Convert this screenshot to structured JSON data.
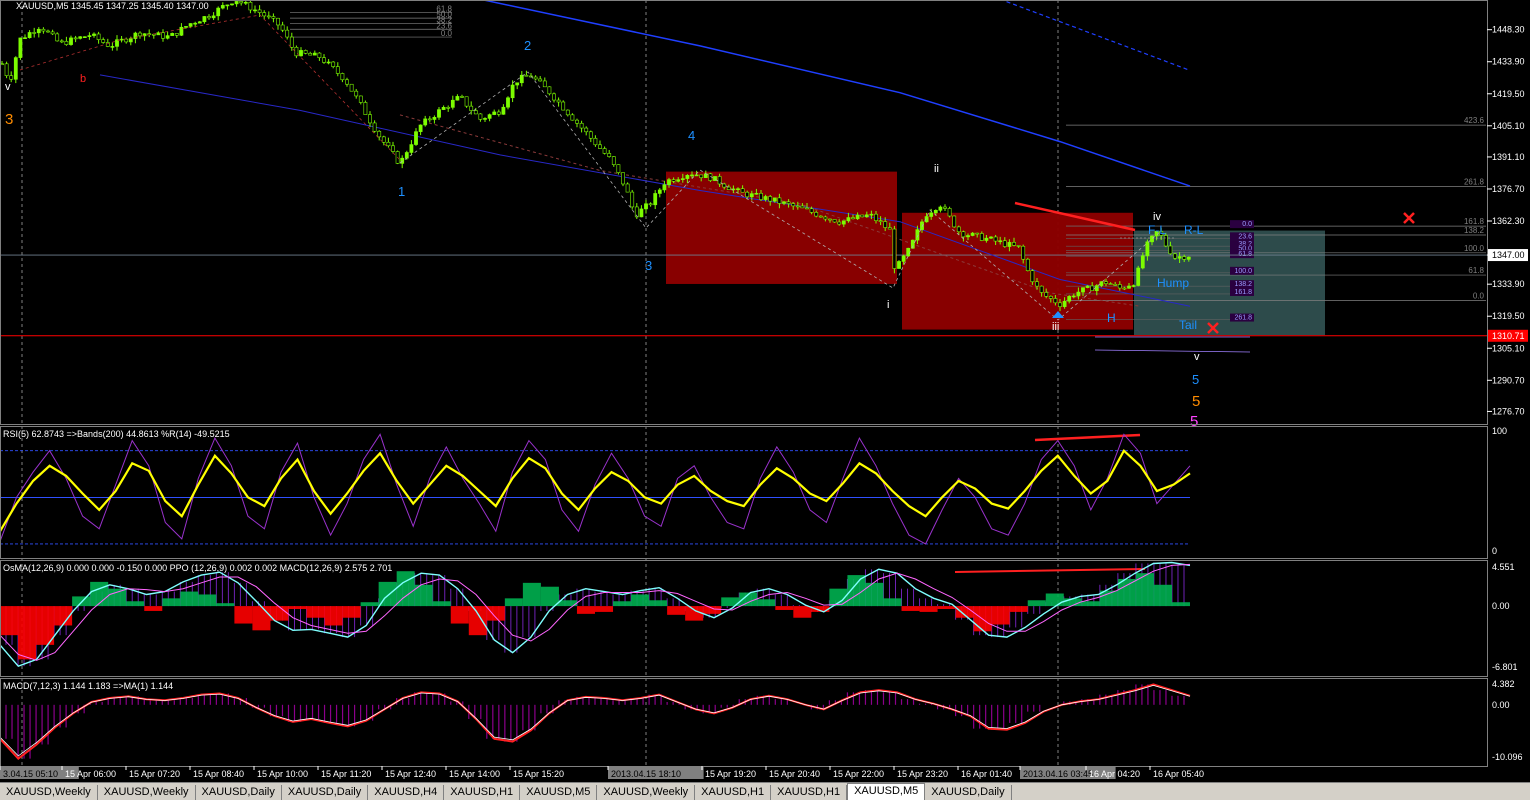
{
  "symbol_header": "XAUUSD,M5  1345.45 1347.25 1345.40 1347.00",
  "chart_data": [
    {
      "type": "candlestick",
      "title": "XAUUSD,M5  1345.45 1347.25 1345.40 1347.00",
      "ylim": [
        1271.5,
        1461.2
      ],
      "y_ticks": [
        "1448.30",
        "1433.90",
        "1419.50",
        "1405.10",
        "1391.10",
        "1376.70",
        "1362.30",
        "1347.00",
        "1333.90",
        "1319.50",
        "1305.10",
        "1290.70",
        "1276.70"
      ],
      "current_price": "1347.00",
      "level_price": "1310.71",
      "x_ticks": [
        "3.04.15 05:10",
        "15 Apr 06:00",
        "15 Apr 07:20",
        "15 Apr 08:40",
        "15 Apr 10:00",
        "15 Apr 11:20",
        "15 Apr 12:40",
        "15 Apr 14:00",
        "15 Apr 15:20",
        "2013.04.15 18:10",
        "15 Apr 19:20",
        "15 Apr 20:40",
        "15 Apr 22:00",
        "15 Apr 23:20",
        "16 Apr 01:40",
        "2013.04.16 03:45",
        "16 Apr 04:20",
        "16 Apr 05:40"
      ],
      "price_path": [
        [
          0,
          1435
        ],
        [
          10,
          1425
        ],
        [
          20,
          1444
        ],
        [
          40,
          1450
        ],
        [
          60,
          1442
        ],
        [
          90,
          1446
        ],
        [
          110,
          1441
        ],
        [
          140,
          1447
        ],
        [
          170,
          1445
        ],
        [
          190,
          1451
        ],
        [
          210,
          1455
        ],
        [
          235,
          1462
        ],
        [
          260,
          1456
        ],
        [
          280,
          1450
        ],
        [
          295,
          1438
        ],
        [
          320,
          1436
        ],
        [
          345,
          1426
        ],
        [
          360,
          1415
        ],
        [
          380,
          1400
        ],
        [
          400,
          1388
        ],
        [
          420,
          1405
        ],
        [
          440,
          1412
        ],
        [
          460,
          1418
        ],
        [
          480,
          1408
        ],
        [
          500,
          1412
        ],
        [
          515,
          1425
        ],
        [
          530,
          1428
        ],
        [
          550,
          1420
        ],
        [
          570,
          1410
        ],
        [
          590,
          1400
        ],
        [
          610,
          1390
        ],
        [
          625,
          1378
        ],
        [
          635,
          1365
        ],
        [
          650,
          1370
        ],
        [
          665,
          1380
        ],
        [
          690,
          1384
        ],
        [
          710,
          1382
        ],
        [
          740,
          1375
        ],
        [
          770,
          1372
        ],
        [
          800,
          1368
        ],
        [
          820,
          1365
        ],
        [
          840,
          1362
        ],
        [
          870,
          1365
        ],
        [
          890,
          1358
        ],
        [
          895,
          1340
        ],
        [
          910,
          1350
        ],
        [
          925,
          1365
        ],
        [
          940,
          1370
        ],
        [
          960,
          1357
        ],
        [
          990,
          1354
        ],
        [
          1020,
          1350
        ],
        [
          1025,
          1342
        ],
        [
          1040,
          1330
        ],
        [
          1060,
          1325
        ],
        [
          1075,
          1330
        ],
        [
          1090,
          1332
        ],
        [
          1105,
          1335
        ],
        [
          1120,
          1332
        ],
        [
          1135,
          1335
        ],
        [
          1145,
          1350
        ],
        [
          1158,
          1358
        ],
        [
          1165,
          1352
        ],
        [
          1175,
          1346
        ],
        [
          1192,
          1347
        ]
      ],
      "fib_levels_right": [
        "423.6",
        "261.8",
        "161.8",
        "138.2",
        "100.0",
        "61.8",
        "0.0"
      ],
      "fib_levels_top": [
        "61.8",
        "50.0",
        "38.2",
        "23.6",
        "0.0"
      ],
      "fib_levels_box": [
        "0.0",
        "23.6",
        "38.2",
        "50.0",
        "61.8",
        "100.0",
        "138.2",
        "161.8",
        "261.8"
      ],
      "wave_labels": [
        "v",
        "3",
        "b",
        "2",
        "1",
        "4",
        "3",
        "ii",
        "i",
        "iii",
        "iv",
        "v",
        "5",
        "5",
        "5",
        "F-L",
        "R-L",
        "Hump",
        "H",
        "Tail"
      ]
    },
    {
      "type": "line",
      "title": "RSI(5) 62.8743  =>Bands(200) 44.8613  %R(14) -49.5215",
      "ylim": [
        0,
        100
      ],
      "y_ticks": [
        "100",
        "0"
      ],
      "series": [
        {
          "name": "RSI(5)",
          "values": [
            18,
            40,
            58,
            70,
            62,
            48,
            35,
            50,
            72,
            66,
            42,
            30,
            55,
            78,
            64,
            45,
            38,
            60,
            75,
            50,
            32,
            48,
            66,
            80,
            58,
            40,
            55,
            70,
            62,
            50,
            38,
            60,
            76,
            68,
            48,
            35,
            52,
            65,
            58,
            45,
            40,
            55,
            62,
            50,
            42,
            38,
            55,
            68,
            60,
            48,
            42,
            56,
            72,
            64,
            50,
            38,
            30,
            45,
            58,
            52,
            40,
            36,
            50,
            66,
            78,
            62,
            48,
            58,
            82,
            70,
            50,
            55,
            64
          ]
        },
        {
          "name": "%R(14)",
          "values": [
            10,
            45,
            65,
            82,
            60,
            30,
            20,
            55,
            90,
            70,
            25,
            12,
            60,
            92,
            70,
            30,
            20,
            65,
            88,
            45,
            15,
            40,
            75,
            95,
            55,
            22,
            60,
            85,
            60,
            40,
            18,
            65,
            90,
            75,
            35,
            18,
            55,
            80,
            60,
            30,
            22,
            60,
            70,
            45,
            25,
            20,
            60,
            85,
            65,
            35,
            25,
            60,
            92,
            70,
            40,
            15,
            8,
            35,
            60,
            45,
            20,
            15,
            40,
            75,
            90,
            70,
            35,
            60,
            95,
            80,
            40,
            55,
            70
          ]
        }
      ],
      "bands": [
        44.8613,
        82,
        8
      ]
    },
    {
      "type": "bar",
      "title": "OsMA(12,26,9) 0.000 0.000 -0.150 0.000  PPO (12,26,9) 0.002 0.002  MACD(12,26,9) 2.575 2.701",
      "ylim": [
        -6.801,
        4.551
      ],
      "y_ticks": [
        "4.551",
        "0.00",
        "-6.801"
      ],
      "values": [
        -3,
        -5.5,
        -4,
        -2,
        1,
        2.5,
        1.8,
        0.5,
        -0.5,
        0.8,
        1.5,
        1.2,
        0.3,
        -1.8,
        -2.5,
        -1.5,
        -0.3,
        -1.2,
        -2,
        -1.2,
        0.4,
        2.5,
        3.6,
        2.2,
        0.5,
        -1.8,
        -3,
        -1.5,
        0.8,
        2.4,
        2,
        0.6,
        -0.8,
        -0.6,
        0.5,
        1.2,
        0.6,
        -0.9,
        -1.5,
        -0.8,
        0.9,
        1.4,
        0.7,
        -0.4,
        -1.2,
        -0.6,
        1.8,
        3.2,
        2.4,
        0.8,
        -0.5,
        -0.6,
        -0.3,
        -1.2,
        -2.6,
        -1.9,
        -0.6,
        0.6,
        1.3,
        0.8,
        0.5,
        1.6,
        2.8,
        3.4,
        2.2,
        0.4
      ],
      "series": [
        {
          "name": "MACD(12,26,9)",
          "values": [
            -4,
            -6.2,
            -5.5,
            -3,
            -0.5,
            1.5,
            2.2,
            1.8,
            1.2,
            1.5,
            2.5,
            3.2,
            3.5,
            2.4,
            0.5,
            -1.5,
            -2.5,
            -2.4,
            -2.8,
            -3.2,
            -2,
            0.8,
            2.4,
            3.4,
            3.2,
            1.8,
            -0.5,
            -3.5,
            -4.8,
            -3.2,
            -0.5,
            1.2,
            1.8,
            1.5,
            1.2,
            1.6,
            1.9,
            0.8,
            -0.5,
            -1.2,
            -0.2,
            1.4,
            1.8,
            1.2,
            0.1,
            -0.6,
            0.6,
            2.8,
            3.8,
            3.4,
            1.8,
            0.8,
            0.2,
            -1.4,
            -3,
            -3.2,
            -2.2,
            -0.8,
            0.4,
            1,
            1.2,
            2.2,
            3.4,
            4.4,
            4.5,
            4.2
          ]
        },
        {
          "name": "Signal",
          "values": [
            -3,
            -5,
            -5.6,
            -4.8,
            -2.6,
            -0.4,
            1.2,
            1.8,
            1.7,
            1.5,
            1.8,
            2.4,
            3,
            3,
            2,
            0.3,
            -1.2,
            -2,
            -2.4,
            -2.8,
            -2.6,
            -1,
            0.8,
            2.2,
            2.8,
            2.6,
            1.2,
            -1,
            -3,
            -3.6,
            -2.4,
            -0.4,
            1,
            1.4,
            1.4,
            1.4,
            1.6,
            1.3,
            0.5,
            -0.3,
            -0.4,
            0.5,
            1.2,
            1.4,
            0.8,
            0.1,
            0.2,
            1.4,
            2.8,
            3.4,
            2.8,
            1.8,
            0.9,
            -0.4,
            -1.8,
            -2.6,
            -2.6,
            -1.6,
            -0.4,
            0.4,
            0.9,
            1.6,
            2.6,
            3.6,
            4.2,
            4.3
          ]
        }
      ]
    },
    {
      "type": "bar",
      "title": "MACD(7,12,3) 1.144 1.183  =>MA(1) 1.144",
      "ylim": [
        -10.096,
        4.382
      ],
      "y_ticks": [
        "4.382",
        "0.00",
        "-10.096"
      ],
      "values": [
        -6,
        -9.5,
        -7,
        -4,
        -1.5,
        0.5,
        1.2,
        1.5,
        1,
        0.8,
        1.2,
        1.8,
        2,
        1.2,
        -0.5,
        -2,
        -3,
        -2.5,
        -3.2,
        -3.8,
        -2.8,
        -0.8,
        1.2,
        2.2,
        2,
        0.6,
        -2.5,
        -6,
        -6.5,
        -4.5,
        -1.5,
        0.8,
        1.4,
        1.2,
        0.8,
        1.2,
        1.8,
        0.5,
        -0.8,
        -1.5,
        -0.5,
        1,
        1.6,
        1,
        0,
        -0.8,
        0.8,
        2.2,
        2.6,
        2.2,
        1,
        0.2,
        -0.8,
        -2,
        -4.2,
        -4.4,
        -3.2,
        -1.2,
        0,
        0.6,
        1,
        1.8,
        2.6,
        3.6,
        2.6,
        1.6
      ]
    }
  ],
  "tabs": [
    {
      "label": "XAUUSD,Weekly",
      "active": false
    },
    {
      "label": "XAUUSD,Weekly",
      "active": false
    },
    {
      "label": "XAUUSD,Daily",
      "active": false
    },
    {
      "label": "XAUUSD,Daily",
      "active": false
    },
    {
      "label": "XAUUSD,H4",
      "active": false
    },
    {
      "label": "XAUUSD,H1",
      "active": false
    },
    {
      "label": "XAUUSD,M5",
      "active": false
    },
    {
      "label": "XAUUSD,Weekly",
      "active": false
    },
    {
      "label": "XAUUSD,H1",
      "active": false
    },
    {
      "label": "XAUUSD,H1",
      "active": false
    },
    {
      "label": "XAUUSD,M5",
      "active": true
    },
    {
      "label": "XAUUSD,Daily",
      "active": false
    }
  ],
  "colors": {
    "bull": "#7cfc00",
    "bear": "#000000",
    "grid": "#808080",
    "rsi": "#ffff00",
    "wr": "#9932cc",
    "osma_pos": "#00b050",
    "osma_neg": "#ff0000",
    "macd_hist": "#8b008b",
    "wave_cyan": "#1e90ff",
    "wave_orange": "#ff8c00",
    "box_red": "#8b0000",
    "box_teal": "#2f4f4f"
  }
}
